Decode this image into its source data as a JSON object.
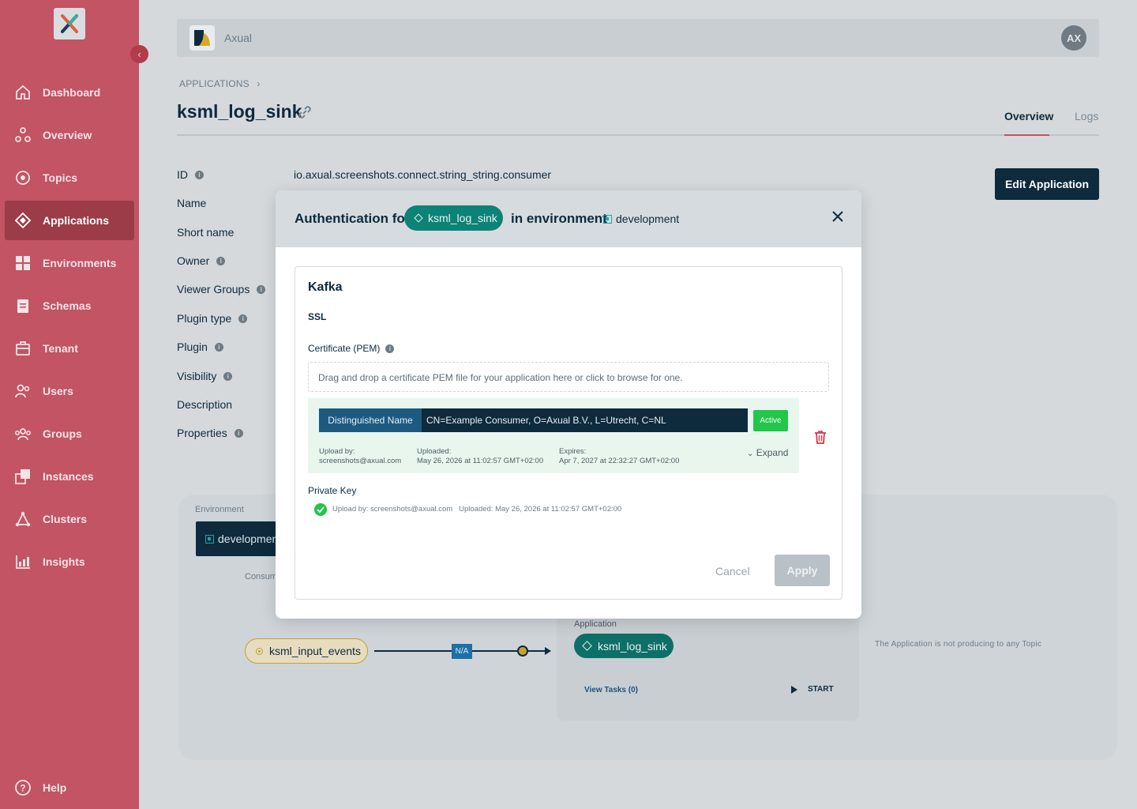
{
  "sidebar": {
    "items": [
      {
        "label": "Dashboard",
        "icon": "home-icon"
      },
      {
        "label": "Overview",
        "icon": "overview-icon"
      },
      {
        "label": "Topics",
        "icon": "topic-icon"
      },
      {
        "label": "Applications",
        "icon": "application-icon"
      },
      {
        "label": "Environments",
        "icon": "environment-icon"
      },
      {
        "label": "Schemas",
        "icon": "schema-icon"
      },
      {
        "label": "Tenant",
        "icon": "tenant-icon"
      },
      {
        "label": "Users",
        "icon": "users-icon"
      },
      {
        "label": "Groups",
        "icon": "groups-icon"
      },
      {
        "label": "Instances",
        "icon": "instances-icon"
      },
      {
        "label": "Clusters",
        "icon": "clusters-icon"
      },
      {
        "label": "Insights",
        "icon": "insights-icon"
      }
    ],
    "active": "Applications",
    "help_label": "Help"
  },
  "topbar": {
    "tenant_name": "Axual",
    "avatar_initials": "AX"
  },
  "breadcrumb": "APPLICATIONS",
  "page": {
    "title": "ksml_log_sink",
    "tabs": [
      "Overview",
      "Logs"
    ],
    "active_tab": "Overview",
    "edit_button": "Edit Application"
  },
  "fields": {
    "labels": [
      "ID",
      "Name",
      "Short name",
      "Owner",
      "Viewer Groups",
      "Plugin type",
      "Plugin",
      "Visibility",
      "Description",
      "Properties"
    ],
    "id_value": "io.axual.screenshots.connect.string_string.consumer"
  },
  "flow": {
    "environment_label": "Environment",
    "environment_name": "development",
    "consumes_label": "Consum",
    "topic": "ksml_input_events",
    "na_badge": "N/A",
    "application_label": "Application",
    "application_name": "ksml_log_sink",
    "view_tasks": "View Tasks (0)",
    "start": "START",
    "not_producing": "The Application is not producing to any Topic"
  },
  "modal": {
    "title_prefix": "Authentication for",
    "app_name": "ksml_log_sink",
    "title_middle": "in environment",
    "environment": "development",
    "section_title": "Kafka",
    "protocol": "SSL",
    "certificate_label": "Certificate (PEM)",
    "dropzone_text": "Drag and drop a certificate PEM file for your application here or click to browse for one.",
    "certificate": {
      "dn_label": "Distinguished Name",
      "dn_value": "CN=Example Consumer, O=Axual B.V., L=Utrecht, C=NL",
      "status": "Active",
      "upload_by_label": "Upload by:",
      "upload_by": "screenshots@axual.com",
      "uploaded_label": "Uploaded:",
      "uploaded": "May 26, 2026 at 11:02:57 GMT+02:00",
      "expires_label": "Expires:",
      "expires": "Apr 7, 2027 at 22:32:27 GMT+02:00",
      "expand": "Expand"
    },
    "private_key_label": "Private Key",
    "private_key_info": "Upload by: screenshots@axual.com   Uploaded: May 26, 2026 at 11:02:57 GMT+02:00",
    "cancel": "Cancel",
    "apply": "Apply"
  },
  "colors": {
    "sidebar": "#c25463",
    "sidebar_active": "#9c3c48",
    "navy": "#0e2a3d",
    "teal_pill": "#0d8277",
    "active_green": "#22c64a"
  }
}
